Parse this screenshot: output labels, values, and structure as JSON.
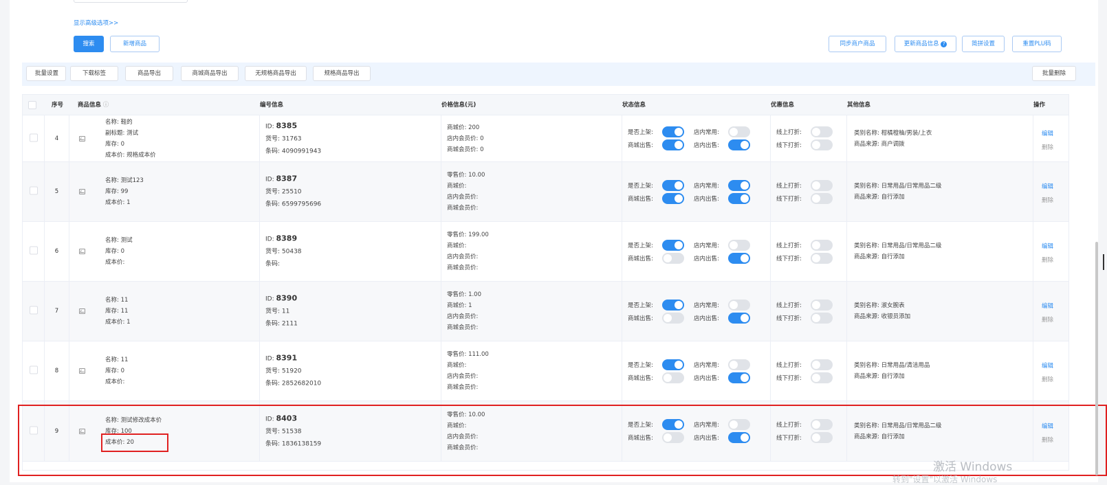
{
  "search": {
    "advanced_link": "显示高级选项>>",
    "search_button": "搜索",
    "add_button": "新增商品"
  },
  "top_right_buttons": [
    "同步商户商品",
    "更新商品信息",
    "简拼设置",
    "重置PLU码"
  ],
  "toolbar": {
    "buttons": [
      "批量设置",
      "下载标签",
      "商品导出",
      "商城商品导出",
      "无规格商品导出",
      "规格商品导出"
    ],
    "batch_delete": "批量删除"
  },
  "columns": {
    "seq": "序号",
    "info": "商品信息",
    "code": "编号信息",
    "price": "价格信息(元)",
    "status": "状态信息",
    "promo": "优惠信息",
    "other": "其他信息",
    "op": "操作"
  },
  "labels": {
    "on_shelf": "是否上架:",
    "store_common": "店内常用:",
    "mall_sale": "商城出售:",
    "store_sale": "店内出售:",
    "online_discount": "线上打折:",
    "offline_discount": "线下打折:",
    "edit": "编辑",
    "delete": "删除"
  },
  "rows": [
    {
      "seq": "4",
      "info": [
        "名称: 鞋的",
        "副标题: 测试",
        "库存: 0",
        "成本价: 规格成本价"
      ],
      "id": "8385",
      "code_lines": [
        "货号: 31763",
        "条码: 4090991943"
      ],
      "price": [
        "商城价: 200",
        "店内会员价: 0",
        "商城会员价: 0"
      ],
      "toggles": {
        "on_shelf": true,
        "store_common": false,
        "mall_sale": true,
        "store_sale": true,
        "online_discount": false,
        "offline_discount": false
      },
      "other": [
        "类别名称: 柑橘橙柚/男装/上衣",
        "商品来源: 商户调拨"
      ]
    },
    {
      "seq": "5",
      "info": [
        "名称: 测试123",
        "库存: 99",
        "成本价: 1"
      ],
      "id": "8387",
      "code_lines": [
        "货号: 25510",
        "条码: 6599795696"
      ],
      "price": [
        "零售价: 10.00",
        "商城价:",
        "店内会员价:",
        "商城会员价:"
      ],
      "toggles": {
        "on_shelf": true,
        "store_common": true,
        "mall_sale": true,
        "store_sale": true,
        "online_discount": false,
        "offline_discount": false
      },
      "other": [
        "类别名称: 日常用品/日常用品二级",
        "商品来源: 自行添加"
      ]
    },
    {
      "seq": "6",
      "info": [
        "名称: 测试",
        "库存: 0",
        "成本价:"
      ],
      "id": "8389",
      "code_lines": [
        "货号: 50438",
        "条码:"
      ],
      "price": [
        "零售价: 199.00",
        "商城价:",
        "店内会员价:",
        "商城会员价:"
      ],
      "toggles": {
        "on_shelf": true,
        "store_common": false,
        "mall_sale": false,
        "store_sale": true,
        "online_discount": false,
        "offline_discount": false
      },
      "other": [
        "类别名称: 日常用品/日常用品二级",
        "商品来源: 自行添加"
      ]
    },
    {
      "seq": "7",
      "info": [
        "名称: 11",
        "库存: 11",
        "成本价: 1"
      ],
      "id": "8390",
      "code_lines": [
        "货号: 11",
        "条码: 2111"
      ],
      "price": [
        "零售价: 1.00",
        "商城价: 1",
        "店内会员价:",
        "商城会员价:"
      ],
      "toggles": {
        "on_shelf": true,
        "store_common": false,
        "mall_sale": false,
        "store_sale": true,
        "online_discount": false,
        "offline_discount": false
      },
      "other": [
        "类别名称: 淑女腕表",
        "商品来源: 收银员添加"
      ]
    },
    {
      "seq": "8",
      "info": [
        "名称: 11",
        "库存: 0",
        "成本价:"
      ],
      "id": "8391",
      "code_lines": [
        "货号: 51920",
        "条码: 2852682010"
      ],
      "price": [
        "零售价: 111.00",
        "商城价:",
        "店内会员价:",
        "商城会员价:"
      ],
      "toggles": {
        "on_shelf": true,
        "store_common": false,
        "mall_sale": false,
        "store_sale": true,
        "online_discount": false,
        "offline_discount": false
      },
      "other": [
        "类别名称: 日常用品/清洁用品",
        "商品来源: 自行添加"
      ]
    },
    {
      "seq": "9",
      "info": [
        "名称: 测试修改成本价",
        "库存: 100",
        "成本价: 20"
      ],
      "id": "8403",
      "code_lines": [
        "货号: 51538",
        "条码: 1836138159"
      ],
      "price": [
        "零售价: 10.00",
        "商城价:",
        "店内会员价:",
        "商城会员价:"
      ],
      "toggles": {
        "on_shelf": true,
        "store_common": false,
        "mall_sale": false,
        "store_sale": true,
        "online_discount": false,
        "offline_discount": false
      },
      "other": [
        "类别名称: 日常用品/日常用品二级",
        "商品来源: 自行添加"
      ]
    }
  ],
  "watermark": {
    "line1": "激活 Windows",
    "line2": "转到\"设置\"以激活 Windows"
  },
  "colors": {
    "primary": "#2d8cf0",
    "highlight": "#e02020",
    "toolbar_bg": "#eef5fe"
  }
}
